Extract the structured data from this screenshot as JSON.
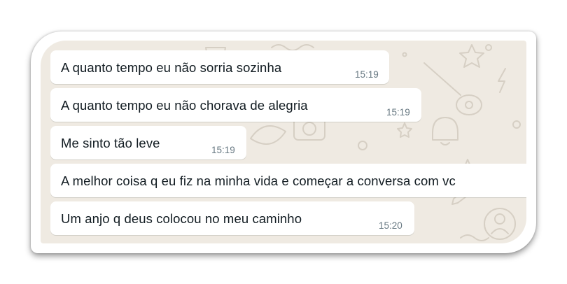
{
  "chat": {
    "background_color": "#efeae2",
    "bubble_color": "#ffffff",
    "messages": [
      {
        "text": "A quanto tempo eu não sorria sozinha",
        "time": "15:19"
      },
      {
        "text": "A quanto tempo eu não chorava de alegria",
        "time": "15:19"
      },
      {
        "text": "Me sinto tão leve",
        "time": "15:19"
      },
      {
        "text": "A melhor coisa q eu fiz na minha vida e começar a conversa com vc",
        "time": ""
      },
      {
        "text": "Um anjo q deus colocou no meu caminho",
        "time": "15:20"
      }
    ]
  }
}
